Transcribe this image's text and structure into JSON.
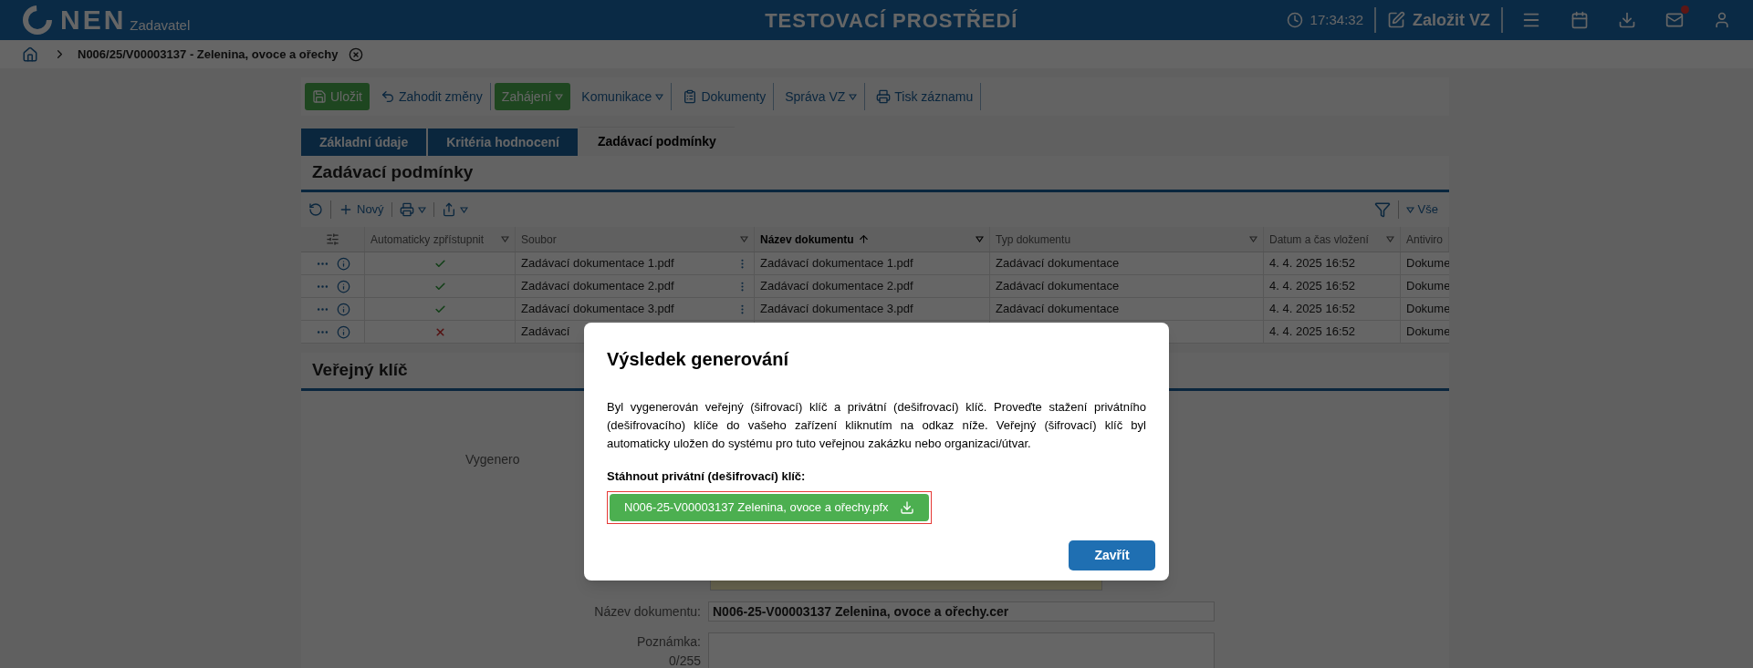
{
  "header": {
    "logo": "NEN",
    "logo_sub": "Zadavatel",
    "env_title": "TESTOVACÍ PROSTŘEDÍ",
    "time": "17:34:32",
    "create_button": "Založit VZ",
    "mail_unread": true
  },
  "breadcrumb": {
    "title": "N006/25/V00003137 - Zelenina, ovoce a ořechy"
  },
  "toolbar": [
    {
      "label": "Uložit",
      "kind": "primary",
      "dropdown": false
    },
    {
      "label": "Zahodit změny",
      "kind": "undo",
      "dropdown": false
    },
    {
      "label": "Zahájení",
      "kind": "primary",
      "dropdown": true
    },
    {
      "label": "Komunikace",
      "kind": "plain",
      "dropdown": true
    },
    {
      "label": "Dokumenty",
      "kind": "docs",
      "dropdown": false
    },
    {
      "label": "Správa VZ",
      "kind": "plain",
      "dropdown": true
    },
    {
      "label": "Tisk záznamu",
      "kind": "print",
      "dropdown": false
    }
  ],
  "tabs": [
    {
      "label": "Základní údaje",
      "selected": false
    },
    {
      "label": "Kritéria hodnocení",
      "selected": false
    },
    {
      "label": "Zadávací podmínky",
      "selected": true
    }
  ],
  "section": {
    "title": "Zadávací podmínky",
    "new_label": "Nový",
    "filter_label": "Vše"
  },
  "table": {
    "columns": [
      {
        "label": "Automaticky zpřístupnit",
        "sorted": false
      },
      {
        "label": "Soubor",
        "sorted": false
      },
      {
        "label": "Název dokumentu",
        "sorted": true
      },
      {
        "label": "Typ dokumentu",
        "sorted": false
      },
      {
        "label": "Datum a čas vložení",
        "sorted": false
      },
      {
        "label": "Antiviro",
        "sorted": false
      }
    ],
    "rows": [
      {
        "published": true,
        "file": "Zadávací dokumentace 1.pdf",
        "name": "Zadávací dokumentace 1.pdf",
        "type": "Zadávací dokumentace",
        "date": "4. 4. 2025 16:52",
        "antivirus": "Dokume"
      },
      {
        "published": true,
        "file": "Zadávací dokumentace 2.pdf",
        "name": "Zadávací dokumentace 2.pdf",
        "type": "Zadávací dokumentace",
        "date": "4. 4. 2025 16:52",
        "antivirus": "Dokume"
      },
      {
        "published": true,
        "file": "Zadávací dokumentace 3.pdf",
        "name": "Zadávací dokumentace 3.pdf",
        "type": "Zadávací dokumentace",
        "date": "4. 4. 2025 16:52",
        "antivirus": "Dokume"
      },
      {
        "published": false,
        "file": "Zadávací",
        "date": "4. 4. 2025 16:52",
        "antivirus": "Dokume"
      }
    ]
  },
  "key_section": {
    "title": "Veřejný klíč",
    "generated_label": "Vygenero",
    "name_label": "Název dokumentu:",
    "name_value": "N006-25-V00003137 Zelenina, ovoce a ořechy.cer",
    "note_label": "Poznámka:",
    "note_counter": "0/255"
  },
  "modal": {
    "title": "Výsledek generování",
    "message": "Byl vygenerován veřejný (šifrovací) klíč a privátní (dešifrovací) klíč. Proveďte stažení privátního (dešifrovacího) klíče do vašeho zařízení kliknutím na odkaz níže. Veřejný (šifrovací) klíč byl automaticky uložen do systému pro tuto veřejnou zakázku nebo organizaci/útvar.",
    "download_label": "Stáhnout privátní (dešifrovací) klíč:",
    "download_file": "N006-25-V00003137 Zelenina, ovoce a ořechy.pfx",
    "close_button": "Zavřít"
  }
}
